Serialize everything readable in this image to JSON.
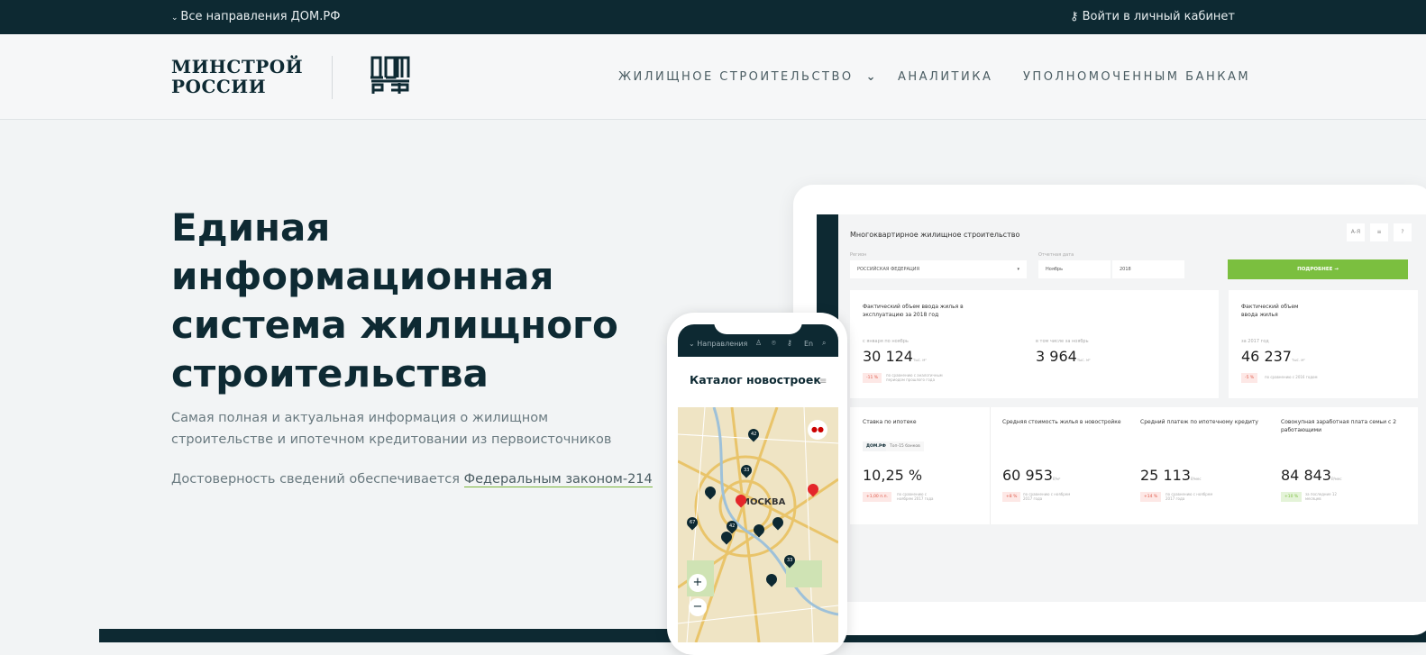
{
  "topbar": {
    "directions": "Все направления ДОМ.РФ",
    "login": "Войти в личный кабинет"
  },
  "header": {
    "logo_minstroy": "МИНСТРОЙ РОССИИ",
    "logo_domrf": "ДОМ РФ",
    "nav": [
      {
        "label": "ЖИЛИЩНОЕ СТРОИТЕЛЬСТВО"
      },
      {
        "label": "АНАЛИТИКА"
      },
      {
        "label": "УПОЛНОМОЧЕННЫМ БАНКАМ"
      }
    ]
  },
  "hero": {
    "title": "Единая информационная система жилищного строительства",
    "subtitle": "Самая полная и актуальная информация о жилищном строительстве и ипотечном кредитовании из первоисточников",
    "reliability": "Достоверность сведений обеспечивается ",
    "law_link": "Федеральным законом-214"
  },
  "dashboard": {
    "title": "Многоквартирное жилищное строительство",
    "buttons": [
      "А-Я",
      "≡",
      "?"
    ],
    "region_label": "Регион",
    "region": "РОССИЙСКАЯ ФЕДЕРАЦИЯ",
    "date_label": "Отчетная дата",
    "month": "Ноябрь",
    "year": "2018",
    "more": "ПОДРОБНЕЕ →",
    "card1": {
      "title": "Фактический объем ввода жилья в эксплуатацию за 2018 год",
      "a_label": "с января по ноябрь",
      "a_value": "30 124",
      "a_unit": "тыс. м²",
      "a_badge": "-11 %",
      "a_note": "по сравнению с аналогичным периодом прошлого года",
      "b_label": "в том числе за ноябрь",
      "b_value": "3 964",
      "b_unit": "тыс. м²"
    },
    "card2": {
      "title": "Фактический объем ввода жилья",
      "label": "за 2017 год",
      "value": "46 237",
      "unit": "тыс. м²",
      "badge": "-5 %",
      "note": "по сравнению с 2016 годом"
    },
    "metrics": [
      {
        "title": "Ставка по ипотеке",
        "tabs": [
          "ДОМ.РФ",
          "Топ-15 банков"
        ],
        "value": "10,25 %",
        "unit": "",
        "badge": "+1,00 п.п.",
        "note": "по сравнению с ноябрем 2017 года",
        "positive": false
      },
      {
        "title": "Средняя стоимость жилья в новостройке",
        "value": "60 953",
        "unit": "₽/м²",
        "badge": "+8 %",
        "note": "по сравнению с ноябрем 2017 года",
        "positive": false
      },
      {
        "title": "Средний платеж по ипотечному кредиту",
        "value": "25 113",
        "unit": "₽/мес",
        "badge": "+14 %",
        "note": "по сравнению с ноябрем 2017 года",
        "positive": false
      },
      {
        "title": "Совокупная заработная плата семьи с 2 работающими",
        "value": "84 843",
        "unit": "₽/мес",
        "badge": "+10 %",
        "note": "за последние 12 месяцев",
        "positive": true
      }
    ]
  },
  "phone": {
    "nav": "Направления",
    "lang": "En",
    "title": "Каталог новостроек",
    "city": "МОСКВА",
    "pins": [
      "42",
      "33",
      "67",
      "42",
      "33"
    ],
    "zoom_in": "+",
    "zoom_out": "−"
  }
}
